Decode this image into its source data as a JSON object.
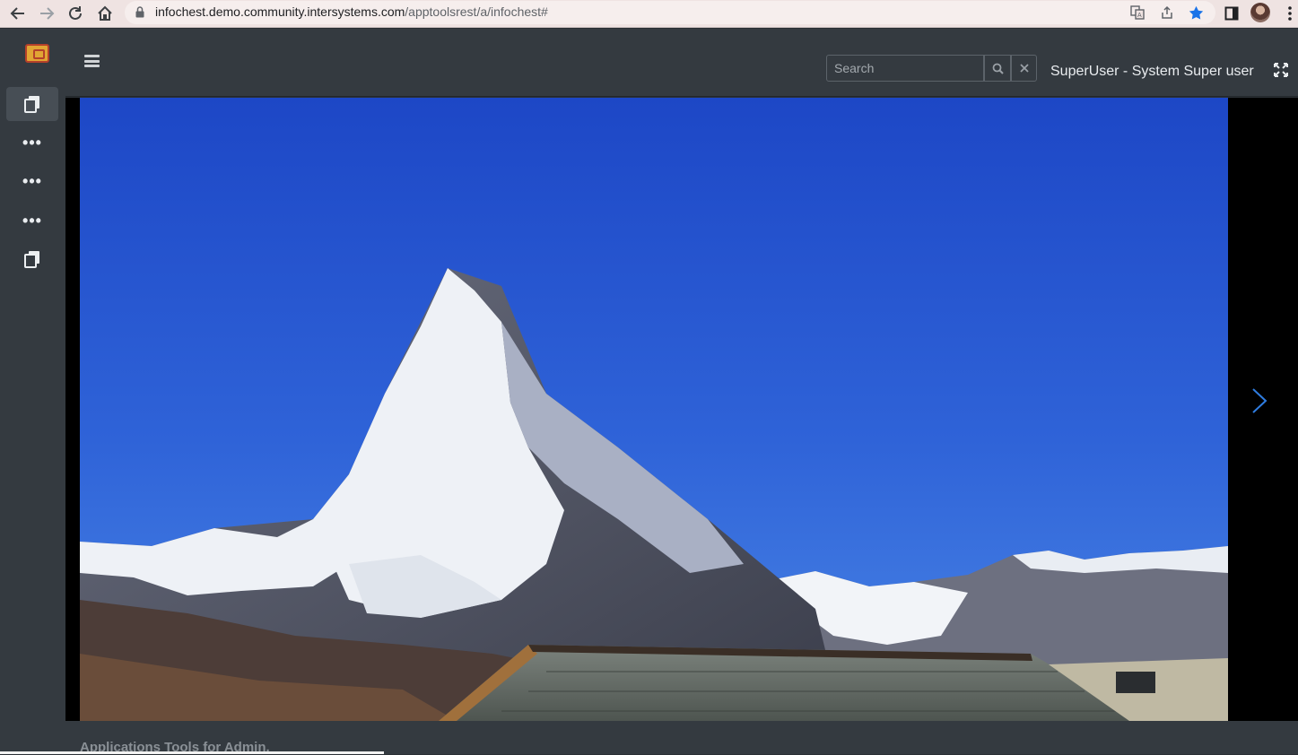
{
  "browser": {
    "url_host": "infochest.demo.community.intersystems.com",
    "url_path": "/apptoolsrest/a/infochest#",
    "icons": [
      "back-icon",
      "forward-icon",
      "reload-icon",
      "home-icon",
      "lock-icon",
      "translate-icon",
      "share-icon",
      "star-icon",
      "side-panel-icon",
      "profile-avatar",
      "menu-kebab-icon"
    ]
  },
  "sidebar": {
    "items": [
      {
        "icon": "copy-icon",
        "active": true
      },
      {
        "icon": "more-dots-icon"
      },
      {
        "icon": "more-dots-icon"
      },
      {
        "icon": "more-dots-icon"
      },
      {
        "icon": "copy-icon"
      }
    ]
  },
  "header": {
    "search_placeholder": "Search",
    "search_value": "",
    "user": "SuperUser - System Super user"
  },
  "viewer": {
    "image_subject": "Matterhorn mountain under blue sky with rooftop in foreground"
  },
  "footer": {
    "text": "Applications Tools for Admin."
  },
  "colors": {
    "sidebar_bg": "#343a40",
    "header_bg": "#343a40",
    "viewer_bg": "#000000",
    "accent_arrow": "#2f7de1",
    "bookmark_star": "#1a73e8"
  }
}
